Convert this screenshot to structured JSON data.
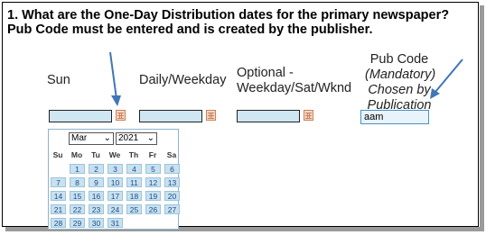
{
  "question": "1. What are the One-Day Distribution dates for the primary newspaper? Pub Code must be entered and is created by the publisher.",
  "columns": {
    "sun": "Sun",
    "daily": "Daily/Weekday",
    "optional_line1": "Optional -",
    "optional_line2": "Weekday/Sat/Wknd",
    "pub_line1": "Pub Code",
    "pub_note1": "(Mandatory)",
    "pub_note2": "Chosen by",
    "pub_note3": "Publication"
  },
  "pub_code": {
    "value": "aam"
  },
  "calendar": {
    "month": "Mar",
    "year": "2021",
    "weekdays": [
      "Su",
      "Mo",
      "Tu",
      "We",
      "Th",
      "Fr",
      "Sa"
    ],
    "weeks": [
      [
        "",
        "1",
        "2",
        "3",
        "4",
        "5",
        "6"
      ],
      [
        "7",
        "8",
        "9",
        "10",
        "11",
        "12",
        "13"
      ],
      [
        "14",
        "15",
        "16",
        "17",
        "18",
        "19",
        "20"
      ],
      [
        "21",
        "22",
        "23",
        "24",
        "25",
        "26",
        "27"
      ],
      [
        "28",
        "29",
        "30",
        "31",
        "",
        "",
        ""
      ]
    ]
  },
  "colors": {
    "input_fill": "#cfe6f3",
    "day_fill": "#c8e1f0",
    "day_text": "#1a4f8a",
    "arrow": "#3f76b8"
  },
  "icons": [
    "calendar-icon",
    "chevron-down-icon",
    "arrow-icon"
  ]
}
